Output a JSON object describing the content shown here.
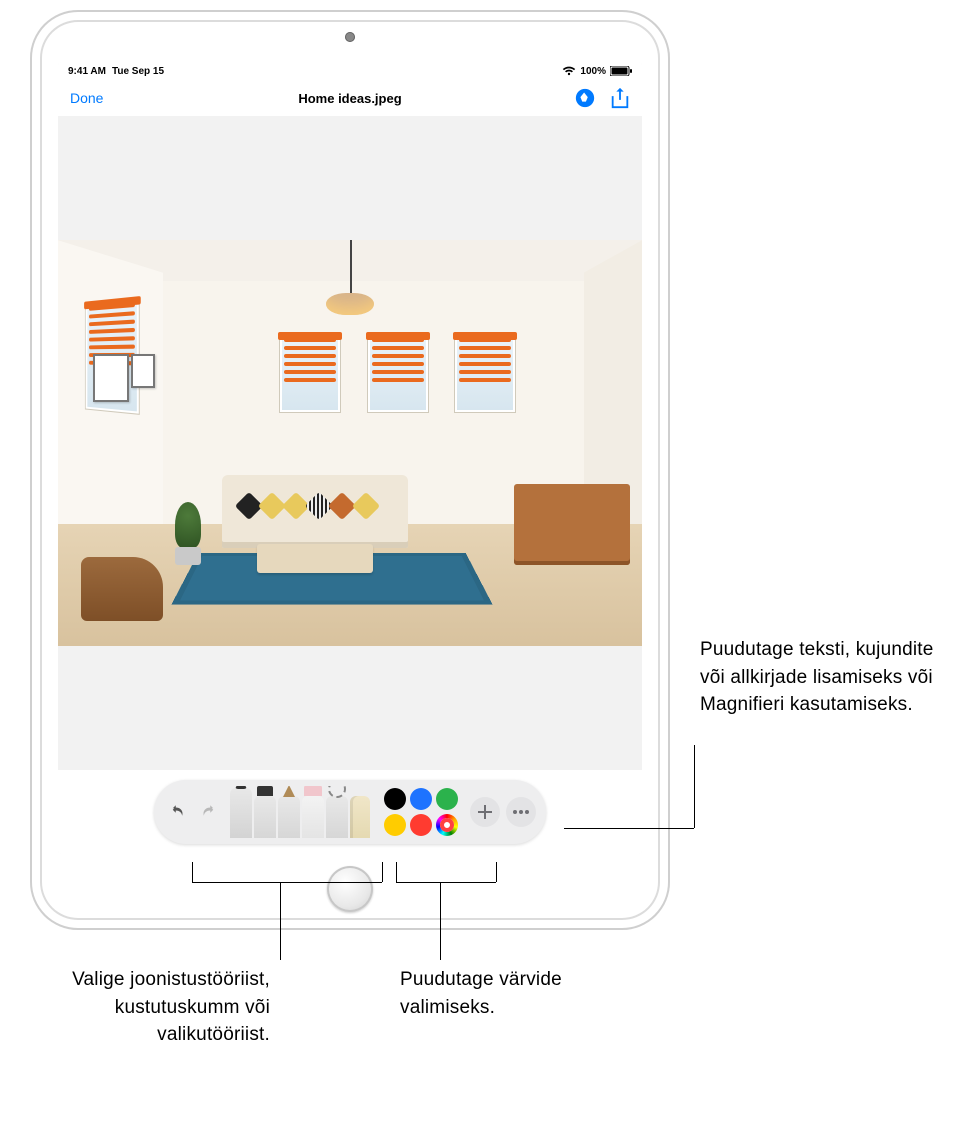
{
  "status": {
    "time": "9:41 AM",
    "date": "Tue Sep 15",
    "battery": "100%"
  },
  "nav": {
    "done": "Done",
    "title": "Home ideas.jpeg"
  },
  "toolbar": {
    "tools": [
      "marker",
      "highlighter",
      "pencil",
      "eraser",
      "lasso",
      "ruler"
    ],
    "colors": {
      "black": "#000000",
      "blue": "#1e73ff",
      "green": "#2bb24c",
      "yellow": "#ffcc00",
      "red": "#ff3b30"
    }
  },
  "callouts": {
    "add": "Puudutage teksti, kujundite või allkirjade lisamiseks või Magnifieri kasutamiseks.",
    "tools": "Valige joonistustööriist, kustutuskumm või valikutööriist.",
    "colors": "Puudutage värvide valimiseks."
  }
}
